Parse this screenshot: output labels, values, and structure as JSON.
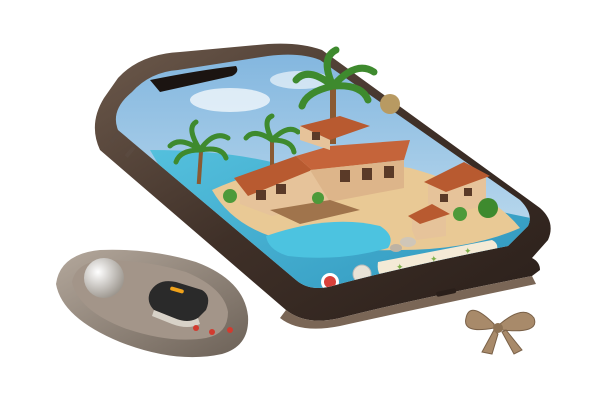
{
  "scene": {
    "background": "#ffffff",
    "phone": {
      "frame_color": "#4a3a30",
      "screen_sky_top": "#7fb4de",
      "screen_sky_bottom": "#d9ecf5",
      "sea_color": "#3aa7c9",
      "sand_color": "#e9c995",
      "roof_color": "#b85a30",
      "wall_color": "#e6c39a"
    },
    "game_ui": {
      "record_button_color": "#d8413b",
      "hud_bar_color": "#f4ead6",
      "hud_star_color": "#7fb04a"
    },
    "controller": {
      "body_color": "#8a7d72",
      "ball_color": "#d6d2cc",
      "device_color": "#2a2a2a",
      "accent_color": "#f0a21a",
      "dot_color": "#d23b2f"
    },
    "bow_charm": {
      "color": "#a88a6a"
    }
  }
}
